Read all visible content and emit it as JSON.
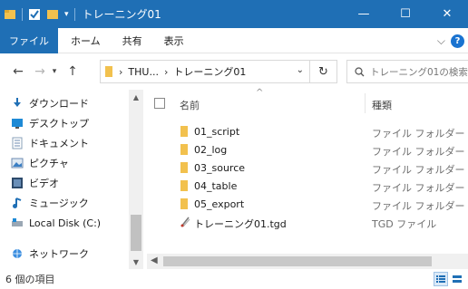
{
  "window": {
    "title": "トレーニング01",
    "minimize_glyph": "—",
    "maximize_glyph": "☐",
    "close_glyph": "✕"
  },
  "ribbon": {
    "tabs": [
      "ファイル",
      "ホーム",
      "共有",
      "表示"
    ],
    "expand_glyph": "⌵",
    "help_glyph": "?"
  },
  "address_bar": {
    "back_glyph": "←",
    "forward_glyph": "→",
    "up_glyph": "↑",
    "path": [
      "THU...",
      "トレーニング01"
    ],
    "separator": "›",
    "dropdown_glyph": "⌄",
    "refresh_glyph": "↻"
  },
  "search": {
    "placeholder": "トレーニング01の検索"
  },
  "sidebar": {
    "items": [
      {
        "label": "ダウンロード",
        "icon": "download-icon"
      },
      {
        "label": "デスクトップ",
        "icon": "desktop-icon"
      },
      {
        "label": "ドキュメント",
        "icon": "documents-icon"
      },
      {
        "label": "ピクチャ",
        "icon": "pictures-icon"
      },
      {
        "label": "ビデオ",
        "icon": "videos-icon"
      },
      {
        "label": "ミュージック",
        "icon": "music-icon"
      },
      {
        "label": "Local Disk (C:)",
        "icon": "drive-icon"
      },
      {
        "label": "ネットワーク",
        "icon": "network-icon"
      }
    ]
  },
  "file_list": {
    "header_name": "名前",
    "header_type": "種類",
    "sort_glyph": "^",
    "rows": [
      {
        "name": "01_script",
        "type": "ファイル フォルダー",
        "icon": "folder-icon"
      },
      {
        "name": "02_log",
        "type": "ファイル フォルダー",
        "icon": "folder-icon"
      },
      {
        "name": "03_source",
        "type": "ファイル フォルダー",
        "icon": "folder-icon"
      },
      {
        "name": "04_table",
        "type": "ファイル フォルダー",
        "icon": "folder-icon"
      },
      {
        "name": "05_export",
        "type": "ファイル フォルダー",
        "icon": "folder-icon"
      },
      {
        "name": "トレーニング01.tgd",
        "type": "TGD ファイル",
        "icon": "tgd-file-icon"
      }
    ]
  },
  "status_bar": {
    "item_count": "6 個の項目"
  },
  "colors": {
    "titlebar": "#1f6fb5",
    "folder": "#f2c14e",
    "selection": "#dbe9f7"
  }
}
